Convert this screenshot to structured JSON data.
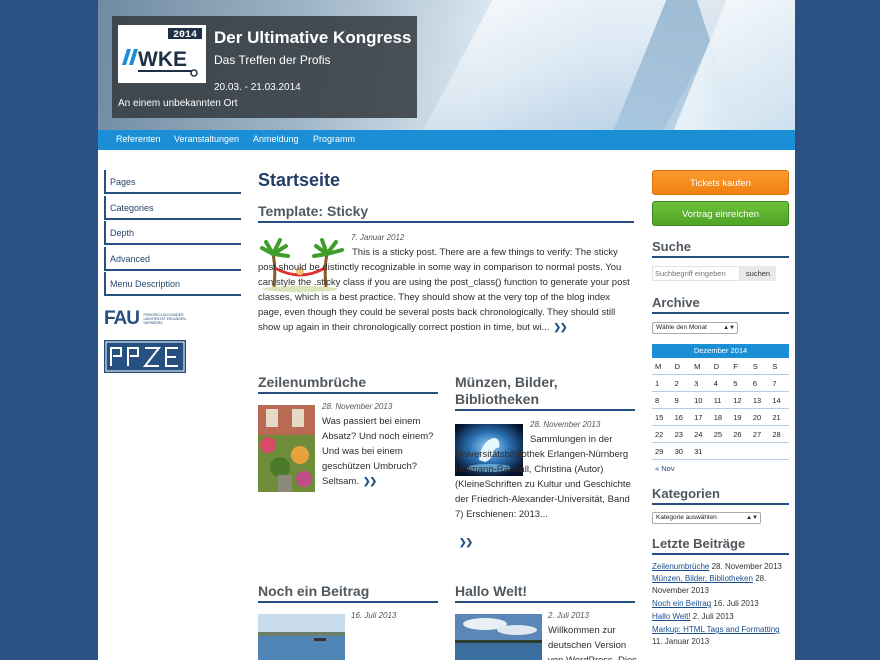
{
  "header": {
    "title": "Der Ultimative Kongress",
    "subtitle": "Das Treffen der Profis",
    "date": "20.03. - 21.03.2014",
    "location": "An einem unbekannten Ort",
    "logo_text": "WKE",
    "logo_year": "2014"
  },
  "nav": {
    "items": [
      "Referenten",
      "Veranstaltungen",
      "Anmeldung",
      "Programm"
    ]
  },
  "leftnav": {
    "items": [
      "Pages",
      "Categories",
      "Depth",
      "Advanced",
      "Menu Description"
    ],
    "fau_logo": "FAU",
    "fau_caption": "FRIEDRICH-ALEXANDER UNIVERSITÄT ERLANGEN-NÜRNBERG",
    "rrze_logo": "RRZE"
  },
  "main": {
    "page_title": "Startseite",
    "posts": [
      {
        "title": "Template: Sticky",
        "date": "7. Januar 2012",
        "excerpt": "This is a sticky post. There are a few things to verify: The sticky post should be distinctly recognizable in some way in comparison to normal posts. You can style the .sticky class if you are using the post_class() function to generate your post classes, which is a best practice. They should show at the very top of the blog index page, even though they could be several posts back chronologically. They should still show up again in their chronologically correct postion in time, but wi...",
        "more": "❯❯"
      },
      {
        "title": "Zeilenumbrüche",
        "date": "28. November 2013",
        "excerpt": "Was passiert bei einem Absatz? Und noch einem? Und was bei einem geschützen Umbruch? Seltsam.",
        "more": "❯❯"
      },
      {
        "title": "Münzen, Bilder, Bibliotheken",
        "date": "28. November 2013",
        "excerpt": "Sammlungen in der Universitätsbibliothek Erlangen-Nürnberg Hofmann-Randall, Christina (Autor) (KleineSchriften zu Kultur und Geschichte der Friedrich-Alexander-Universität, Band 7) Erschienen: 2013...",
        "more": "❯❯"
      },
      {
        "title": "Noch ein Beitrag",
        "date": "16. Juli 2013",
        "excerpt": ""
      },
      {
        "title": "Hallo Welt!",
        "date": "2. Juli 2013",
        "excerpt": "Willkommen zur deutschen Version von WordPress. Dies"
      }
    ]
  },
  "sidebar": {
    "tickets_button": "Tickets kaufen",
    "submit_button": "Vortrag einreichen",
    "search_heading": "Suche",
    "search_placeholder": "Suchbegriff eingeben",
    "search_button": "suchen",
    "archive_heading": "Archive",
    "archive_select": "Wähle den Monat",
    "calendar": {
      "caption": "Dezember 2014",
      "weekdays": [
        "M",
        "D",
        "M",
        "D",
        "F",
        "S",
        "S"
      ],
      "weeks": [
        [
          "1",
          "2",
          "3",
          "4",
          "5",
          "6",
          "7"
        ],
        [
          "8",
          "9",
          "10",
          "11",
          "12",
          "13",
          "14"
        ],
        [
          "15",
          "16",
          "17",
          "18",
          "19",
          "20",
          "21"
        ],
        [
          "22",
          "23",
          "24",
          "25",
          "26",
          "27",
          "28"
        ],
        [
          "29",
          "30",
          "31",
          "",
          "",
          "",
          ""
        ]
      ],
      "prev": "« Nov"
    },
    "categories_heading": "Kategorien",
    "categories_select": "Kategorie auswählen",
    "recent_heading": "Letzte Beiträge",
    "recent": [
      {
        "link": "Zeilenumbrüche",
        "date": "28. November 2013"
      },
      {
        "link": "Münzen, Bilder, Bibliotheken",
        "date": "28. November 2013"
      },
      {
        "link": "Noch ein Beitrag",
        "date": "16. Juli 2013"
      },
      {
        "link": "Hallo Welt!",
        "date": "2. Juli 2013"
      },
      {
        "link": "Markup: HTML Tags and Formatting",
        "date": "11. Januar 2013"
      }
    ]
  },
  "colors": {
    "background": "#2c5183",
    "nav": "#1b8fd6",
    "heading": "#223d68",
    "tickets": "#f7901e",
    "submit": "#5bb12f"
  }
}
